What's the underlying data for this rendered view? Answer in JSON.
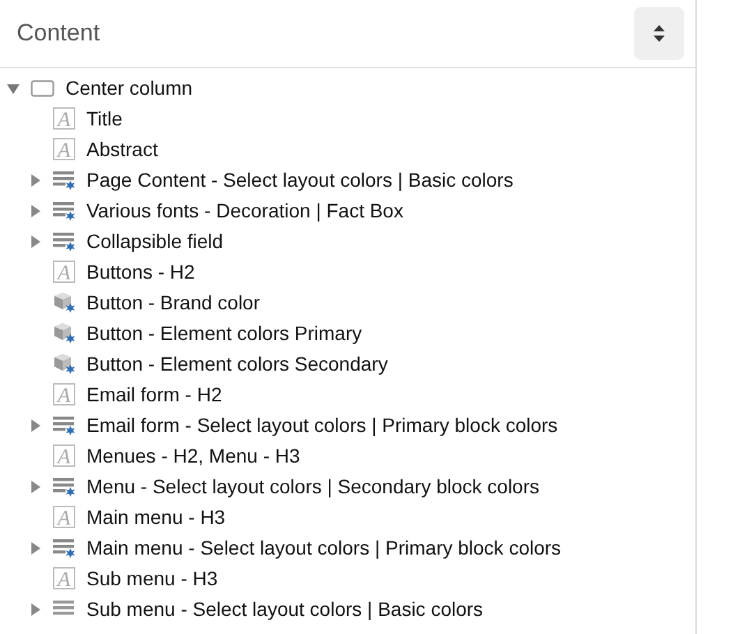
{
  "panel": {
    "title": "Content"
  },
  "tree": [
    {
      "label": "Center column",
      "kind": "container",
      "expanded": true,
      "children": [
        {
          "label": "Title",
          "kind": "text",
          "icon": "A"
        },
        {
          "label": "Abstract",
          "kind": "text",
          "icon": "A"
        },
        {
          "label": "Page Content - Select layout colors | Basic colors",
          "kind": "block",
          "expanded": false
        },
        {
          "label": "Various fonts - Decoration | Fact Box",
          "kind": "block",
          "expanded": false
        },
        {
          "label": "Collapsible field",
          "kind": "block",
          "expanded": false
        },
        {
          "label": "Buttons - H2",
          "kind": "text",
          "icon": "A"
        },
        {
          "label": "Button - Brand color",
          "kind": "component"
        },
        {
          "label": "Button - Element colors Primary",
          "kind": "component"
        },
        {
          "label": "Button - Element colors Secondary",
          "kind": "component"
        },
        {
          "label": "Email form - H2",
          "kind": "text",
          "icon": "A"
        },
        {
          "label": "Email form - Select layout colors | Primary block colors",
          "kind": "block",
          "expanded": false
        },
        {
          "label": "Menues - H2, Menu - H3",
          "kind": "text",
          "icon": "A"
        },
        {
          "label": "Menu - Select layout colors | Secondary block colors",
          "kind": "block",
          "expanded": false
        },
        {
          "label": "Main menu - H3",
          "kind": "text",
          "icon": "A"
        },
        {
          "label": "Main menu - Select layout colors | Primary block colors",
          "kind": "block",
          "expanded": false
        },
        {
          "label": "Sub menu - H3",
          "kind": "text",
          "icon": "A"
        },
        {
          "label": "Sub menu - Select layout colors | Basic colors",
          "kind": "list",
          "expanded": false
        }
      ]
    }
  ]
}
